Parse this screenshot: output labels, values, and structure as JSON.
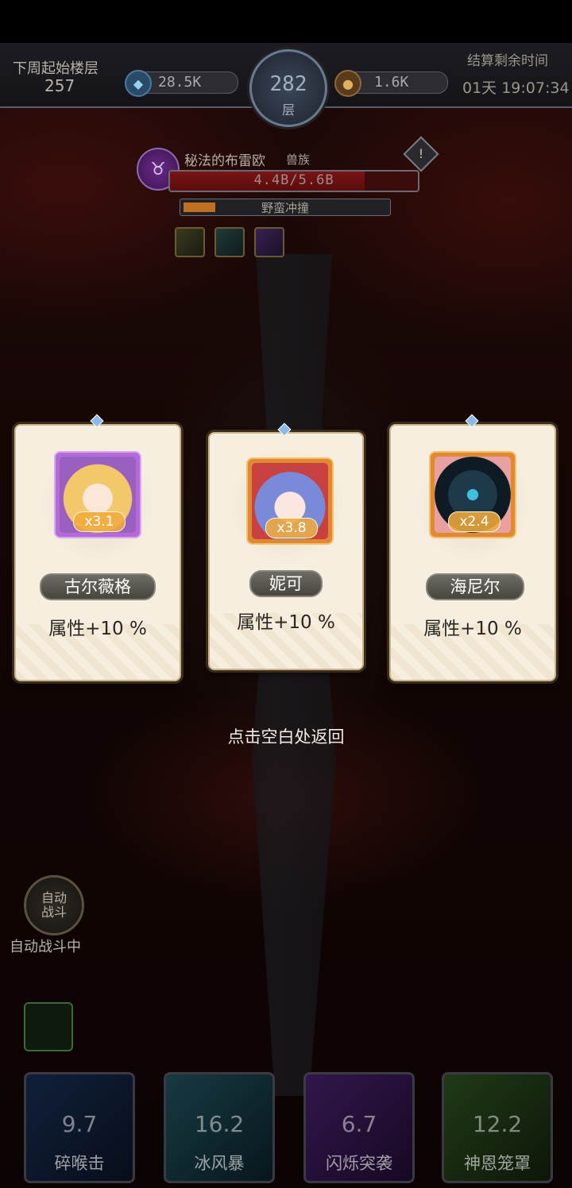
{
  "header": {
    "next_week_floor_label": "下周起始楼层",
    "next_week_floor_value": "257",
    "gems": "28.5K",
    "coins": "1.6K",
    "current_floor": "282",
    "floor_unit": "层",
    "settle_label": "结算剩余时间",
    "settle_time": "01天 19:07:34"
  },
  "boss": {
    "name": "秘法的布雷欧",
    "race": "兽族",
    "hp_text": "4.4B/5.6B",
    "hp_fraction": 0.786,
    "skill_name": "野蛮冲撞",
    "skill_fraction": 0.15
  },
  "cards": [
    {
      "name": "古尔薇格",
      "multiplier": "x3.1",
      "attr": "属性+10 %"
    },
    {
      "name": "妮可",
      "multiplier": "x3.8",
      "attr": "属性+10 %"
    },
    {
      "name": "海尼尔",
      "multiplier": "x2.4",
      "attr": "属性+10 %"
    }
  ],
  "hint": "点击空白处返回",
  "auto_battle": {
    "button": "自动\n战斗",
    "status": "自动战斗中"
  },
  "skills": [
    {
      "name": "碎喉击",
      "cooldown": "9.7"
    },
    {
      "name": "冰风暴",
      "cooldown": "16.2"
    },
    {
      "name": "闪烁突袭",
      "cooldown": "6.7"
    },
    {
      "name": "神恩笼罩",
      "cooldown": "12.2"
    }
  ],
  "colors": {
    "card_bg": "#f6efe0",
    "multiplier": "#f0aa3c",
    "hp_fill": "#7a1414"
  }
}
